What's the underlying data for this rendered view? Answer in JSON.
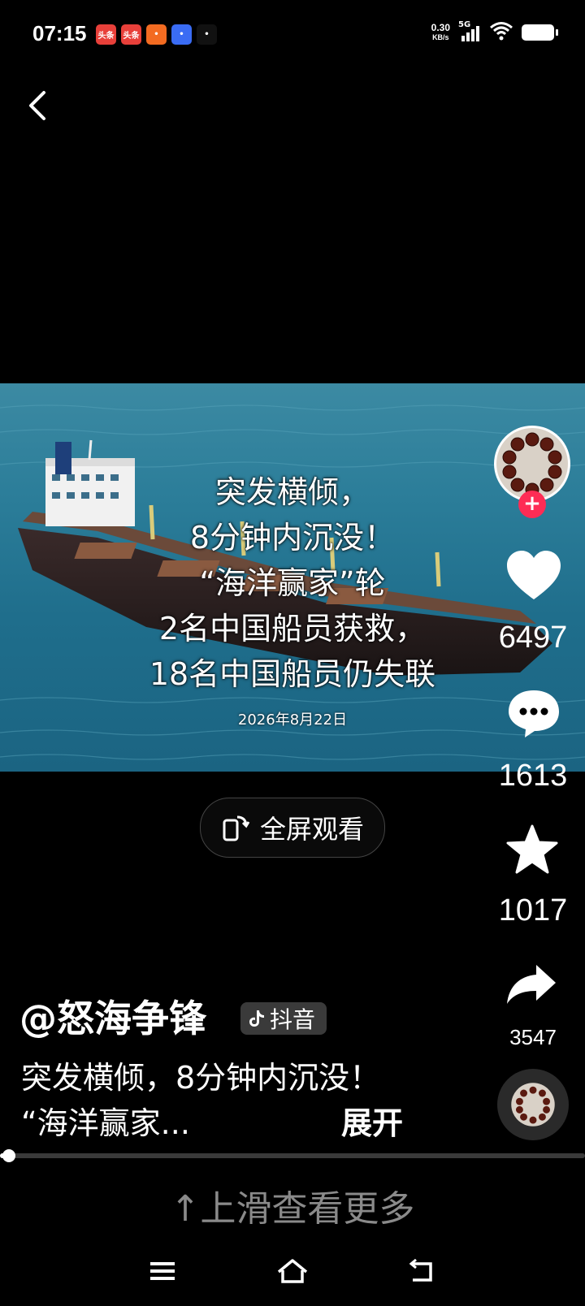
{
  "status_bar": {
    "time": "07:15",
    "net_speed_value": "0.30",
    "net_speed_unit": "KB/s",
    "network_type": "5G",
    "notification_icons": [
      {
        "name": "toutiao-icon",
        "label": "头条",
        "color": "#e8403a"
      },
      {
        "name": "toutiao-lite-icon",
        "label": "头条",
        "color": "#e8403a"
      },
      {
        "name": "app-orange-icon",
        "label": "",
        "color": "#f36b21"
      },
      {
        "name": "app-blue-icon",
        "label": "",
        "color": "#3a6cf4"
      },
      {
        "name": "douyin-icon",
        "label": "",
        "color": "#111111"
      }
    ]
  },
  "video": {
    "caption_lines": [
      "突发横倾，",
      "8分钟内沉没！",
      "“海洋赢家”轮",
      "2名中国船员获救，",
      "18名中国船员仍失联"
    ],
    "date": "2026年8月22日",
    "fullscreen_label": "全屏观看"
  },
  "actions": {
    "likes": "6497",
    "comments": "1613",
    "favorites": "1017",
    "shares": "3547"
  },
  "post": {
    "author": "@怒海争锋",
    "platform": "抖音",
    "description_line1": "突发横倾，8分钟内沉没！",
    "description_line2": "“海洋赢家...",
    "expand_label": "展开",
    "progress": 0.015
  },
  "swipe_hint": "↑上滑查看更多",
  "colors": {
    "accent": "#fe2c55",
    "background": "#000000",
    "sea": "#2b7d99"
  }
}
